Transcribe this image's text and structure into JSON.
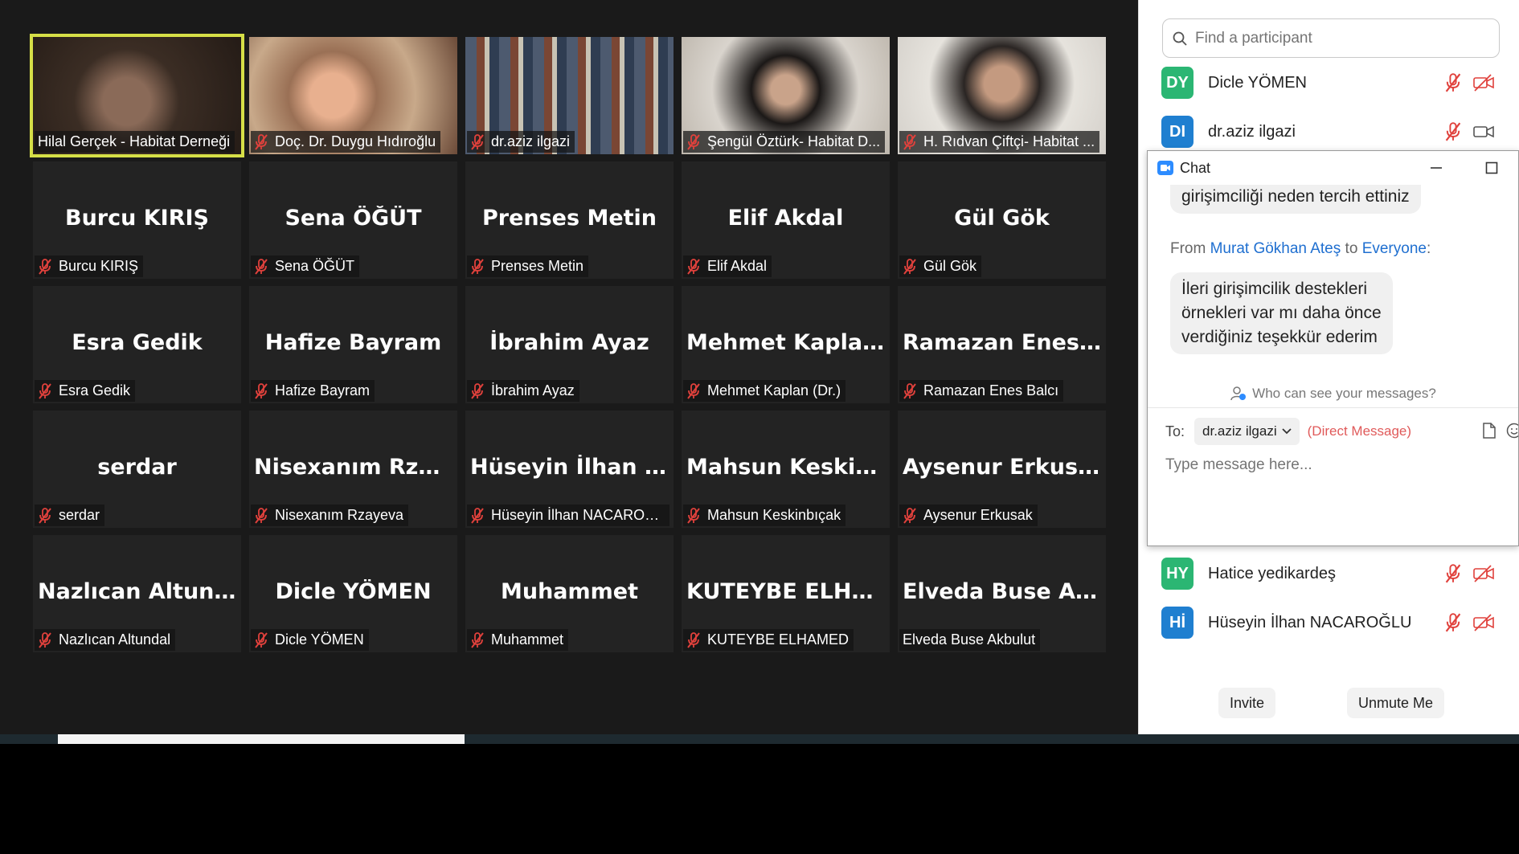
{
  "tiles": [
    {
      "label": "Hilal Gerçek - Habitat Derneği",
      "big": "",
      "muted": false,
      "video": true,
      "active": true
    },
    {
      "label": "Doç. Dr. Duygu Hıdıroğlu",
      "big": "",
      "muted": true,
      "video": true
    },
    {
      "label": "dr.aziz ilgazi",
      "big": "",
      "muted": true,
      "video": true
    },
    {
      "label": "Şengül Öztürk- Habitat D...",
      "big": "",
      "muted": true,
      "video": true
    },
    {
      "label": "H. Rıdvan Çiftçi- Habitat ...",
      "big": "",
      "muted": true,
      "video": true
    },
    {
      "label": "Burcu KIRIŞ",
      "big": "Burcu KIRIŞ",
      "muted": true
    },
    {
      "label": "Sena ÖĞÜT",
      "big": "Sena ÖĞÜT",
      "muted": true
    },
    {
      "label": "Prenses Metin",
      "big": "Prenses Metin",
      "muted": true
    },
    {
      "label": "Elif Akdal",
      "big": "Elif Akdal",
      "muted": true
    },
    {
      "label": "Gül Gök",
      "big": "Gül Gök",
      "muted": true
    },
    {
      "label": "Esra Gedik",
      "big": "Esra Gedik",
      "muted": true
    },
    {
      "label": "Hafize  Bayram",
      "big": "Hafize  Bayram",
      "muted": true
    },
    {
      "label": "İbrahim Ayaz",
      "big": "İbrahim Ayaz",
      "muted": true
    },
    {
      "label": "Mehmet Kaplan (Dr.)",
      "big": "Mehmet  Kaplan...",
      "muted": true
    },
    {
      "label": "Ramazan Enes Balcı",
      "big": "Ramazan  Enes...",
      "muted": true
    },
    {
      "label": "serdar",
      "big": "serdar",
      "muted": true
    },
    {
      "label": "Nisexanım Rzayeva",
      "big": "Nisexanım  Rzay...",
      "muted": true
    },
    {
      "label": "Hüseyin İlhan NACAROĞ...",
      "big": "Hüseyin  İlhan  N...",
      "muted": true
    },
    {
      "label": "Mahsun Keskinbıçak",
      "big": "Mahsun  Keskin...",
      "muted": true
    },
    {
      "label": "Aysenur Erkusak",
      "big": "Aysenur Erkusak",
      "muted": true
    },
    {
      "label": "Nazlıcan Altundal",
      "big": "Nazlıcan Altundal",
      "muted": true
    },
    {
      "label": "Dicle YÖMEN",
      "big": "Dicle YÖMEN",
      "muted": true
    },
    {
      "label": "Muhammet",
      "big": "Muhammet",
      "muted": true
    },
    {
      "label": "KUTEYBE ELHAMED",
      "big": "KUTEYBE  ELHA...",
      "muted": true
    },
    {
      "label": "Elveda Buse Akbulut",
      "big": "Elveda  Buse  Ak...",
      "muted": false
    }
  ],
  "panel": {
    "search_placeholder": "Find a participant",
    "participants": [
      {
        "initials": "DY",
        "name": "Dicle YÖMEN",
        "color": "#2bb673",
        "video_off": true
      },
      {
        "initials": "DI",
        "name": "dr.aziz ilgazi",
        "color": "#1f7fd0",
        "video_off": false
      },
      {
        "initials": "HY",
        "name": "Hatice yedikardeş",
        "color": "#2bb673",
        "video_off": true
      },
      {
        "initials": "Hİ",
        "name": "Hüseyin İlhan NACAROĞLU",
        "color": "#1f7fd0",
        "video_off": true
      }
    ],
    "invite_label": "Invite",
    "unmute_label": "Unmute Me"
  },
  "chat": {
    "title": "Chat",
    "prev_bubble": "girişimciliği neden tercih ettiniz",
    "from_prefix": "From",
    "from_name": "Murat Gökhan Ateş",
    "to_word": "to",
    "to_name": "Everyone",
    "message_lines": [
      "İleri girişimcilik destekleri",
      "örnekleri var mı daha önce",
      "verdiğiniz teşekkür ederim"
    ],
    "who_can_see": "Who can see your messages?",
    "to_label": "To:",
    "recipient": "dr.aziz ilgazi",
    "dm_label": "(Direct Message)",
    "input_placeholder": "Type message here..."
  },
  "colors": {
    "active_speaker": "#d6df47",
    "muted_red": "#e0413c"
  }
}
